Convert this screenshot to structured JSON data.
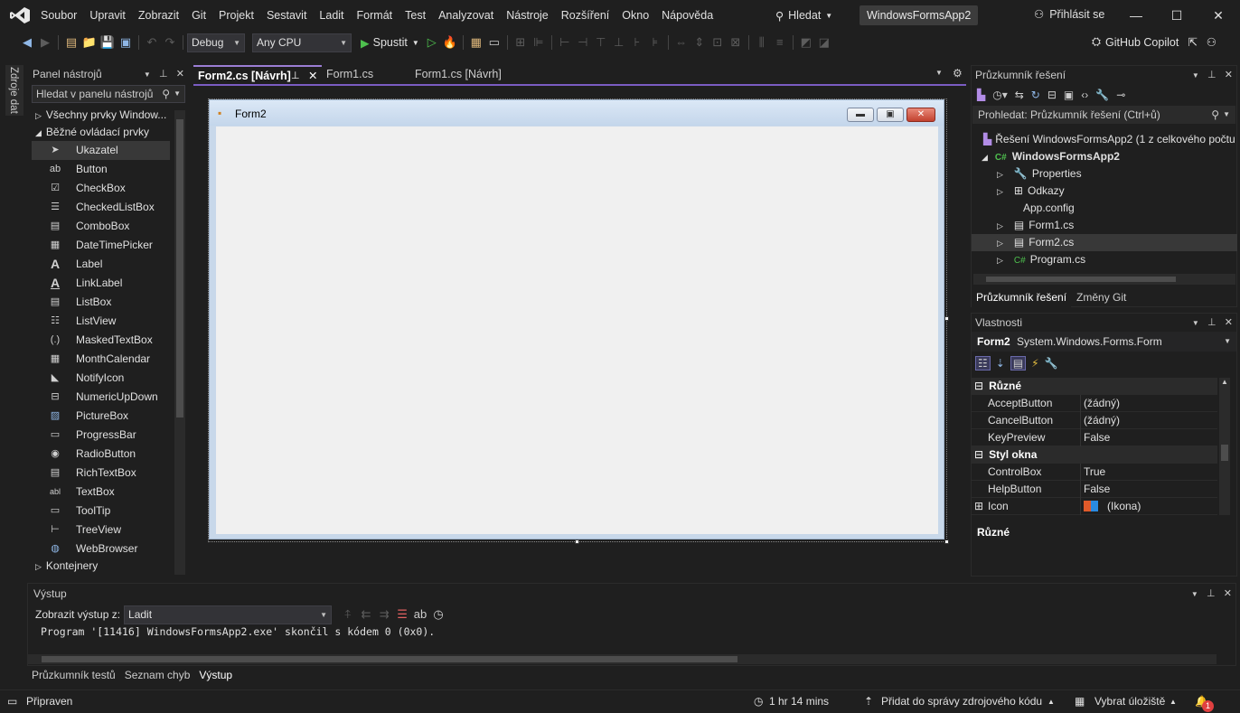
{
  "menu": [
    "Soubor",
    "Upravit",
    "Zobrazit",
    "Git",
    "Projekt",
    "Sestavit",
    "Ladit",
    "Formát",
    "Test",
    "Analyzovat",
    "Nástroje",
    "Rozšíření",
    "Okno",
    "Nápověda"
  ],
  "search_label": "Hledat",
  "project_name": "WindowsFormsApp2",
  "signin_label": "Přihlásit se",
  "toolbar": {
    "config": "Debug",
    "platform": "Any CPU",
    "run_label": "Spustit",
    "copilot_label": "GitHub Copilot"
  },
  "datastrip_label": "Zdroje dat",
  "toolbox": {
    "title": "Panel nástrojů",
    "search_placeholder": "Hledat v panelu nástrojů",
    "cat_all": "Všechny prvky Window...",
    "cat_common": "Běžné ovládací prvky",
    "cat_containers": "Kontejnery",
    "items": [
      "Ukazatel",
      "Button",
      "CheckBox",
      "CheckedListBox",
      "ComboBox",
      "DateTimePicker",
      "Label",
      "LinkLabel",
      "ListBox",
      "ListView",
      "MaskedTextBox",
      "MonthCalendar",
      "NotifyIcon",
      "NumericUpDown",
      "PictureBox",
      "ProgressBar",
      "RadioButton",
      "RichTextBox",
      "TextBox",
      "ToolTip",
      "TreeView",
      "WebBrowser"
    ]
  },
  "tabs": [
    {
      "label": "Form2.cs [Návrh]",
      "active": true
    },
    {
      "label": "Form1.cs",
      "active": false
    },
    {
      "label": "Form1.cs [Návrh]",
      "active": false
    }
  ],
  "form_title": "Form2",
  "solution_explorer": {
    "title": "Průzkumník řešení",
    "search_placeholder": "Prohledat: Průzkumník řešení (Ctrl+ů)",
    "solution": "Řešení WindowsFormsApp2 (1 z celkového počtu",
    "project": "WindowsFormsApp2",
    "items": [
      "Properties",
      "Odkazy",
      "App.config",
      "Form1.cs",
      "Form2.cs",
      "Program.cs"
    ],
    "tab_main": "Průzkumník řešení",
    "tab_git": "Změny Git"
  },
  "properties": {
    "title": "Vlastnosti",
    "object_name": "Form2",
    "object_type": "System.Windows.Forms.Form",
    "cat_misc": "Různé",
    "cat_window_style": "Styl okna",
    "rows_misc": [
      {
        "name": "AcceptButton",
        "value": "(žádný)"
      },
      {
        "name": "CancelButton",
        "value": "(žádný)"
      },
      {
        "name": "KeyPreview",
        "value": "False"
      }
    ],
    "rows_style": [
      {
        "name": "ControlBox",
        "value": "True"
      },
      {
        "name": "HelpButton",
        "value": "False"
      },
      {
        "name": "Icon",
        "value": "(Ikona)"
      }
    ],
    "description_title": "Různé"
  },
  "output": {
    "title": "Výstup",
    "show_label": "Zobrazit výstup z:",
    "source": "Ladit",
    "text": "Program '[11416] WindowsFormsApp2.exe' skončil s kódem 0 (0x0)."
  },
  "bottom_tabs": [
    "Průzkumník testů",
    "Seznam chyb",
    "Výstup"
  ],
  "status": {
    "ready": "Připraven",
    "time": "1 hr 14 mins",
    "source_control": "Přidat do správy zdrojového kódu",
    "repo": "Vybrat úložiště",
    "notifications": "1"
  },
  "colors": {
    "accent": "#7a5cc2",
    "background": "#1f1f1f"
  }
}
